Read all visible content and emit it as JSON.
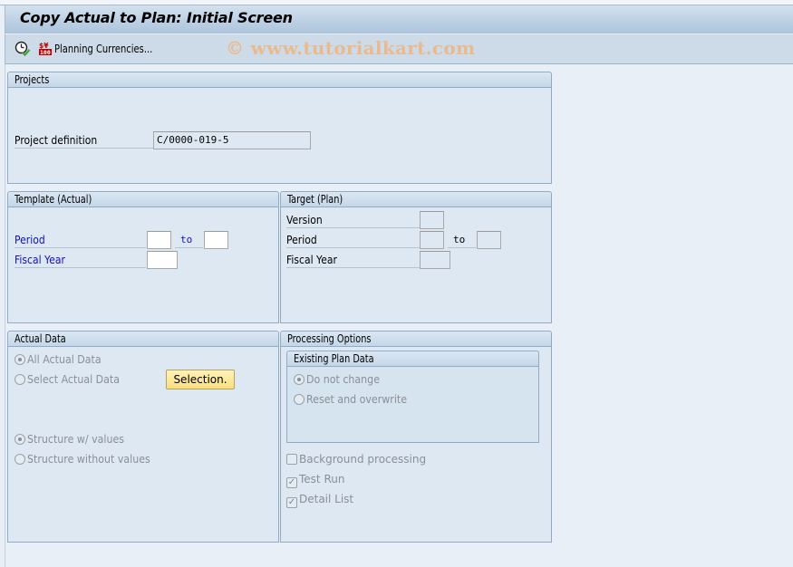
{
  "window": {
    "title": "Copy Actual to Plan: Initial Screen",
    "watermark": "© www.tutorialkart.com"
  },
  "toolbar": {
    "execute_icon": "execute-clock-icon",
    "currency_icon": "currency-icon",
    "planning_currencies_label": "Planning Currencies..."
  },
  "projects": {
    "title": "Projects",
    "project_definition_label": "Project definition",
    "project_definition_value": "C/0000-019-5"
  },
  "template_actual": {
    "title": "Template (Actual)",
    "period_label": "Period",
    "period_from": "",
    "to_label": "to",
    "period_to": "",
    "fiscal_year_label": "Fiscal Year",
    "fiscal_year_value": ""
  },
  "target_plan": {
    "title": "Target (Plan)",
    "version_label": "Version",
    "version_value": "",
    "period_label": "Period",
    "period_from": "",
    "to_label": "to",
    "period_to": "",
    "fiscal_year_label": "Fiscal Year",
    "fiscal_year_value": ""
  },
  "actual_data": {
    "title": "Actual Data",
    "options": [
      {
        "label": "All Actual Data",
        "selected": true
      },
      {
        "label": "Select Actual Data",
        "selected": false
      }
    ],
    "selection_button": "Selection.",
    "structure_options": [
      {
        "label": "Structure w/ values",
        "selected": true
      },
      {
        "label": "Structure without values",
        "selected": false
      }
    ]
  },
  "processing_options": {
    "title": "Processing Options",
    "existing_plan_data": {
      "title": "Existing Plan Data",
      "options": [
        {
          "label": "Do not change",
          "selected": true
        },
        {
          "label": "Reset and overwrite",
          "selected": false
        }
      ]
    },
    "checkboxes": [
      {
        "label": "Background processing",
        "checked": false
      },
      {
        "label": "Test Run",
        "checked": true
      },
      {
        "label": "Detail List",
        "checked": true
      }
    ]
  }
}
